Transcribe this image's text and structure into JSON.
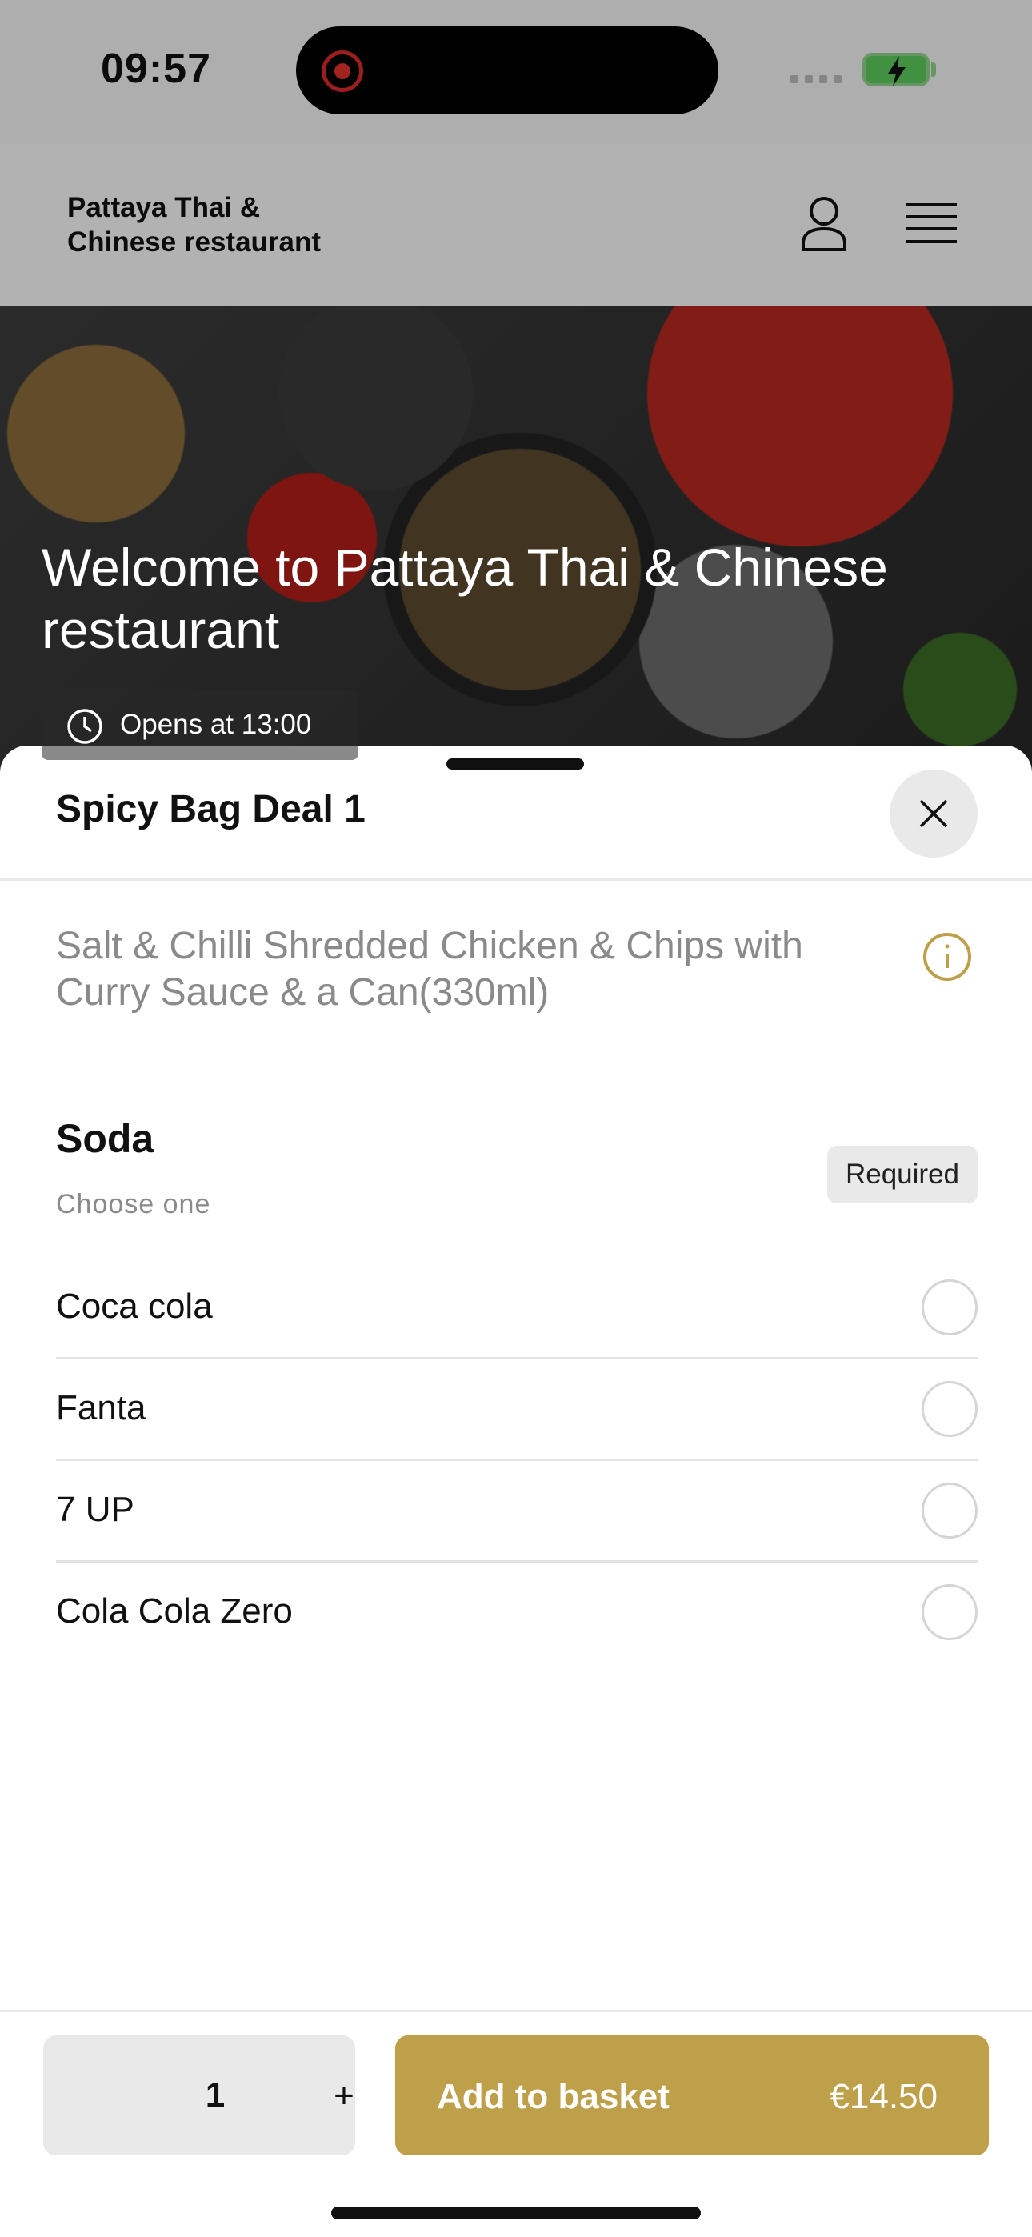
{
  "status_bar": {
    "time": "09:57"
  },
  "header": {
    "brand_line1": "Pattaya Thai &",
    "brand_line2": "Chinese restaurant"
  },
  "hero": {
    "title": "Welcome to Pattaya Thai & Chinese restaurant",
    "hours": "Opens at 13:00"
  },
  "sheet": {
    "title": "Spicy Bag Deal 1",
    "description": "Salt & Chilli Shredded Chicken & Chips with Curry Sauce & a Can(330ml)",
    "group": {
      "title": "Soda",
      "subtitle": "Choose one",
      "badge": "Required"
    },
    "options": [
      {
        "label": "Coca cola"
      },
      {
        "label": "Fanta"
      },
      {
        "label": "7 UP"
      },
      {
        "label": "Cola Cola Zero"
      }
    ]
  },
  "footer": {
    "quantity": "1",
    "plus": "+",
    "add_label": "Add to basket",
    "price": "€14.50"
  },
  "colors": {
    "accent": "#bfa04a",
    "scrim": "rgba(0,0,0,0.28)",
    "recording": "#e0332f",
    "battery": "#5cc85a"
  },
  "icons": [
    "user-icon",
    "menu-icon",
    "clock-icon",
    "close-icon",
    "info-icon",
    "battery-charging-icon"
  ]
}
